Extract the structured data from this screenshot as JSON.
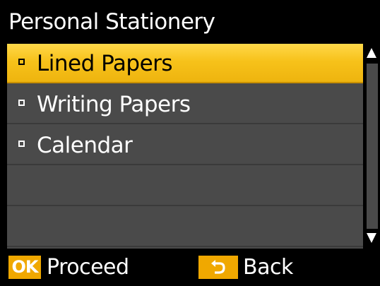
{
  "title": "Personal Stationery",
  "menu": {
    "items": [
      {
        "label": "Lined Papers",
        "selected": true
      },
      {
        "label": "Writing Papers",
        "selected": false
      },
      {
        "label": "Calendar",
        "selected": false
      }
    ],
    "selected_color": "#f7c21a",
    "row_color": "#4a4a4a"
  },
  "scrollbar": {
    "up_icon": "triangle-up",
    "down_icon": "triangle-down"
  },
  "footer": {
    "ok_key": "OK",
    "proceed_label": "Proceed",
    "back_icon": "return-arrow",
    "back_label": "Back",
    "key_color": "#f0a800"
  }
}
